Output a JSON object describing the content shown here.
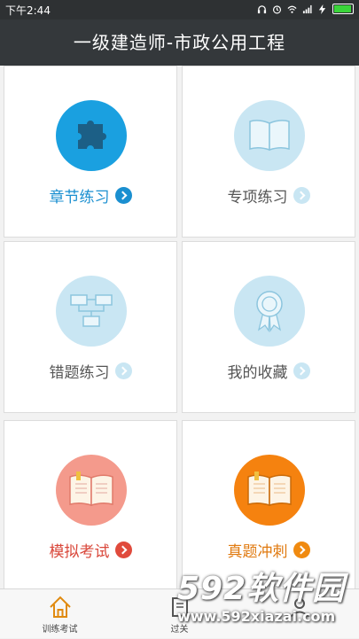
{
  "status_bar": {
    "time": "下午2:44"
  },
  "header": {
    "title": "一级建造师-市政公用工程"
  },
  "cards": [
    {
      "label": "章节练习",
      "icon": "puzzle-icon",
      "circle_color": "#1aa0e0",
      "label_color": "#1a8fd0",
      "arrow_color": "#1a8fd0"
    },
    {
      "label": "专项练习",
      "icon": "book-open-icon",
      "circle_color": "#c9e6f3",
      "label_color": "#555555",
      "arrow_color": "#c9e6f3"
    },
    {
      "label": "错题练习",
      "icon": "flowchart-icon",
      "circle_color": "#c9e6f3",
      "label_color": "#555555",
      "arrow_color": "#c9e6f3"
    },
    {
      "label": "我的收藏",
      "icon": "award-ribbon-icon",
      "circle_color": "#c9e6f3",
      "label_color": "#555555",
      "arrow_color": "#c9e6f3"
    },
    {
      "label": "模拟考试",
      "icon": "open-book-icon",
      "circle_color": "#f49a8c",
      "label_color": "#d9473a",
      "arrow_color": "#e04a3c"
    },
    {
      "label": "真题冲刺",
      "icon": "open-book-icon",
      "circle_color": "#f5820f",
      "label_color": "#e07a10",
      "arrow_color": "#f08a10"
    }
  ],
  "tabs": [
    {
      "label": "训练考试",
      "icon": "home-icon",
      "active": true
    },
    {
      "label": "过关",
      "icon": "book-icon",
      "active": false
    },
    {
      "label": "",
      "icon": "user-icon",
      "active": false
    }
  ],
  "watermark": {
    "brand": "592软件园",
    "url": "www.592xiazai.com"
  }
}
